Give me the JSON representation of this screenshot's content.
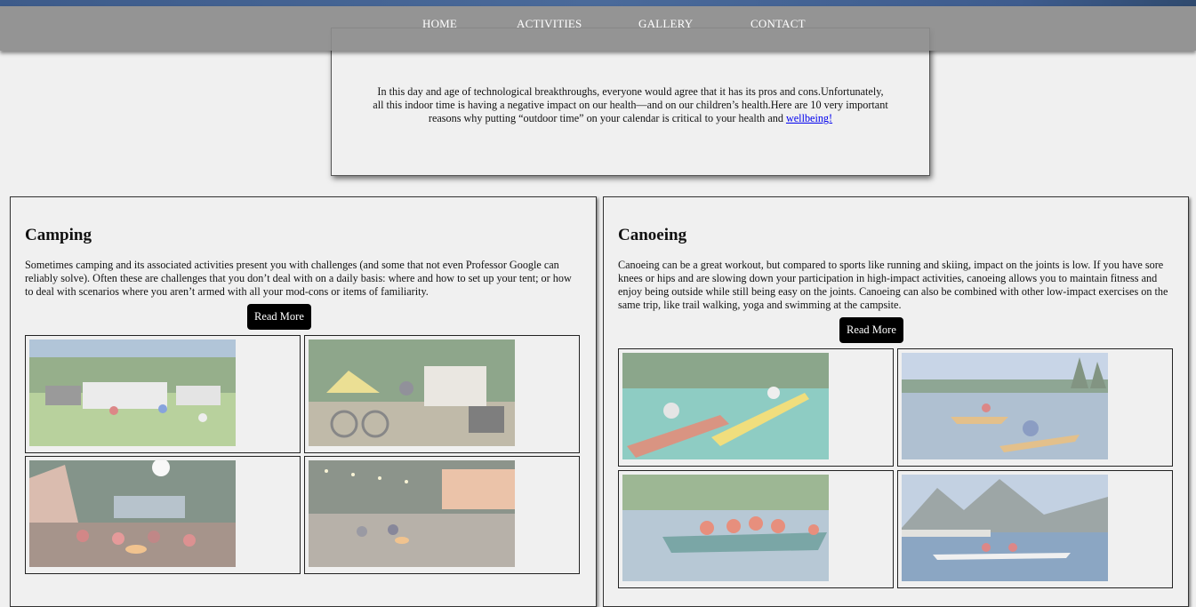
{
  "nav": {
    "items": [
      "HOME",
      "ACTIVITIES",
      "GALLERY",
      "CONTACT"
    ]
  },
  "intro": {
    "text": "In this day and age of technological breakthroughs, everyone would agree that it has its pros and cons.Unfortunately, all this indoor time is having a negative impact on our health—and on our children’s health.Here are 10 very important reasons why putting “outdoor time” on your calendar is critical to your health and ",
    "link": "wellbeing!"
  },
  "cards": [
    {
      "title": "Camping",
      "text": "Sometimes camping and its associated activities present you with challenges (and some that not even Professor Google can reliably solve). Often these are challenges that you don’t deal with on a daily basis: where and how to set up your tent; or how to deal with scenarios where you aren’t armed with all your mod-cons or items of familiarity.",
      "button": "Read More",
      "photos": [
        "camping-caravan-photo",
        "camping-tents-bikes-photo",
        "camping-night-fire-photo",
        "camping-evening-lights-photo"
      ]
    },
    {
      "title": "Canoeing",
      "text": "Canoeing can be a great workout, but compared to sports like running and skiing, impact on the joints is low. If you have sore knees or hips and are slowing down your participation in high-impact activities, canoeing allows you to maintain fitness and enjoy being outside while still being easy on the joints. Canoeing can also be combined with other low-impact exercises on the same trip, like trail walking, yoga and swimming at the campsite.",
      "button": "Read More",
      "photos": [
        "canoe-clear-water-photo",
        "canoe-lake-group-photo",
        "canoe-family-photo",
        "kayak-mountain-bay-photo"
      ]
    }
  ],
  "colors": {
    "navbar": "#8c8c8c",
    "page_bg": "#f0f0f0",
    "button_bg": "#000000",
    "link": "#0000ee"
  }
}
